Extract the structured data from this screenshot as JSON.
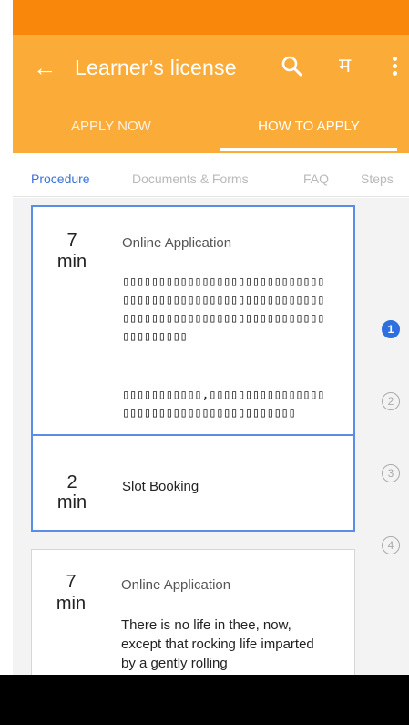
{
  "status_bar": {
    "color": "#f9870c"
  },
  "app_bar": {
    "color": "#fbab38",
    "back_icon": "back-arrow-icon",
    "back_glyph": "←",
    "title": "Learner’s license",
    "search_icon": "search-icon",
    "language_toggle": "म",
    "more_icon": "more-vert-icon"
  },
  "tabs": [
    {
      "label": "APPLY NOW",
      "active": false
    },
    {
      "label": "HOW TO APPLY",
      "active": true
    }
  ],
  "subtabs": [
    {
      "label": "Procedure",
      "active": true
    },
    {
      "label": "Documents & Forms",
      "active": false
    },
    {
      "label": "FAQ",
      "active": false
    },
    {
      "label": "Steps",
      "active": false
    }
  ],
  "cards": [
    {
      "duration_value": "7",
      "duration_unit": "min",
      "title": "Online Application",
      "paragraph1": "▯▯▯▯▯▯▯▯▯▯▯▯▯▯▯▯▯▯▯▯▯▯▯▯▯▯▯▯▯▯▯▯▯▯▯▯▯▯▯▯▯▯▯▯▯▯▯▯▯▯▯▯▯▯▯▯▯▯▯▯▯▯▯▯▯▯▯▯▯▯▯▯▯▯▯▯▯▯▯▯▯▯▯▯▯▯▯▯▯▯▯▯▯",
      "paragraph2": "▯▯▯▯▯▯▯▯▯▯▯,▯▯▯▯▯▯▯▯▯▯▯▯▯▯▯▯▯▯▯▯▯▯▯▯▯▯▯▯▯▯▯▯▯▯▯▯▯▯▯▯"
    },
    {
      "duration_value": "2",
      "duration_unit": "min",
      "title": "Slot Booking"
    },
    {
      "duration_value": "7",
      "duration_unit": "min",
      "title": "Online Application",
      "paragraph1": "There is no life in thee, now, except that rocking life imparted by a gently rolling"
    }
  ],
  "stepper": [
    {
      "number": "1",
      "active": true
    },
    {
      "number": "2",
      "active": false
    },
    {
      "number": "3",
      "active": false
    },
    {
      "number": "4",
      "active": false
    }
  ],
  "colors": {
    "accent": "#2e6fe0",
    "selection_border": "#5a8ee6"
  }
}
